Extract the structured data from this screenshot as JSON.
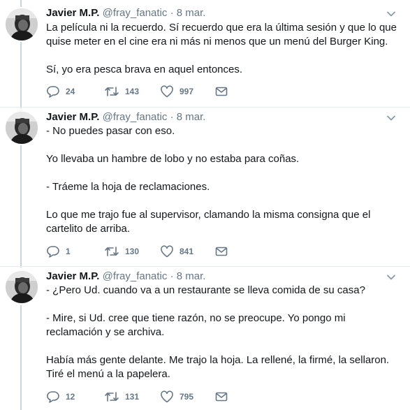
{
  "colors": {
    "text": "#14171a",
    "secondary": "#657786",
    "thread_line": "#ccd6dd",
    "divider": "#e6ecf0"
  },
  "tweets": [
    {
      "name": "Javier M.P.",
      "handle": "@fray_fanatic",
      "separator": "·",
      "date": "8 mar.",
      "paragraphs": [
        "La película ni la recuerdo. Sí recuerdo que era la última sesión y que lo que quise meter en el cine era ni más ni menos que un menú del Burger King.",
        "Sí, yo era pesca brava en aquel entonces."
      ],
      "replies": "24",
      "retweets": "143",
      "likes": "997"
    },
    {
      "name": "Javier M.P.",
      "handle": "@fray_fanatic",
      "separator": "·",
      "date": "8 mar.",
      "paragraphs": [
        "- No puedes pasar con eso.",
        "Yo llevaba un hambre de lobo y no estaba para coñas.",
        "- Tráeme la hoja de reclamaciones.",
        "Lo que me trajo fue al supervisor, clamando la misma consigna que el cartelito de arriba."
      ],
      "replies": "1",
      "retweets": "130",
      "likes": "841"
    },
    {
      "name": "Javier M.P.",
      "handle": "@fray_fanatic",
      "separator": "·",
      "date": "8 mar.",
      "paragraphs": [
        "- ¿Pero Ud. cuando va a un restaurante se lleva comida de su casa?",
        "- Mire, si Ud. cree que tiene razón, no se preocupe. Yo pongo mi reclamación y se archiva.",
        "Había más gente delante. Me trajo la hoja. La rellené, la firmé,  la sellaron. Tiré el menú a la papelera."
      ],
      "replies": "12",
      "retweets": "131",
      "likes": "795"
    }
  ]
}
